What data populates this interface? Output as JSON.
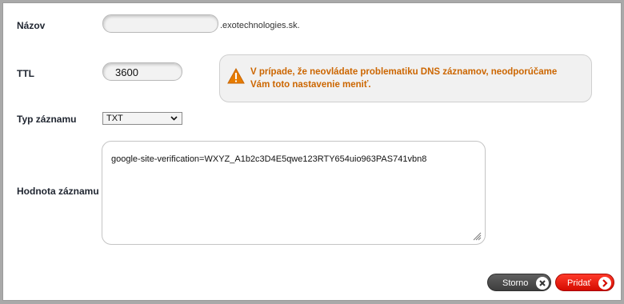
{
  "form": {
    "name_label": "Názov",
    "name_value": "",
    "domain_suffix": ".exotechnologies.sk.",
    "ttl_label": "TTL",
    "ttl_value": "3600",
    "warning_text": "V prípade, že neovládate problematiku DNS záznamov, neodporúčame Vám toto nastavenie meniť.",
    "type_label": "Typ záznamu",
    "type_selected": "TXT",
    "value_label": "Hodnota záznamu",
    "value_text": "google-site-verification=WXYZ_A1b2c3D4E5qwe123RTY654uio963PAS741vbn8"
  },
  "actions": {
    "cancel_label": "Storno",
    "add_label": "Pridať"
  },
  "colors": {
    "warning": "#cc6600",
    "add_button": "#e01400",
    "cancel_button": "#4a4a4a"
  },
  "icons": {
    "warning": "warning-triangle-icon",
    "cancel": "close-circle-icon",
    "add": "arrow-right-circle-icon"
  }
}
